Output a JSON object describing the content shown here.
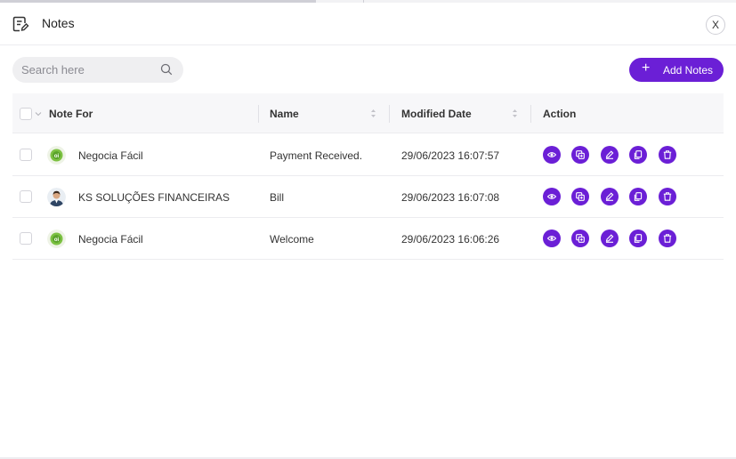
{
  "header": {
    "title": "Notes",
    "close_label": "X"
  },
  "search": {
    "placeholder": "Search here"
  },
  "toolbar": {
    "add_label": "Add Notes",
    "add_glyph": "+"
  },
  "table": {
    "columns": [
      "Note For",
      "Name",
      "Modified Date",
      "Action"
    ],
    "rows": [
      {
        "note_for": "Negocia Fácil",
        "name": "Payment Received.",
        "modified": "29/06/2023 16:07:57",
        "avatar": "oi-logo"
      },
      {
        "note_for": "KS SOLUÇÕES FINANCEIRAS",
        "name": "Bill",
        "modified": "29/06/2023 16:07:08",
        "avatar": "person-photo"
      },
      {
        "note_for": "Negocia Fácil",
        "name": "Welcome",
        "modified": "29/06/2023 16:06:26",
        "avatar": "oi-logo"
      }
    ],
    "actions": [
      "eye-icon",
      "copy-icon",
      "edit-icon",
      "duplicate-icon",
      "delete-icon"
    ]
  },
  "colors": {
    "accent": "#6b1fd6",
    "oi_green": "#7cc142"
  },
  "icons": {
    "header": "notes-edit-icon",
    "search": "search-icon",
    "close": "close-icon"
  }
}
